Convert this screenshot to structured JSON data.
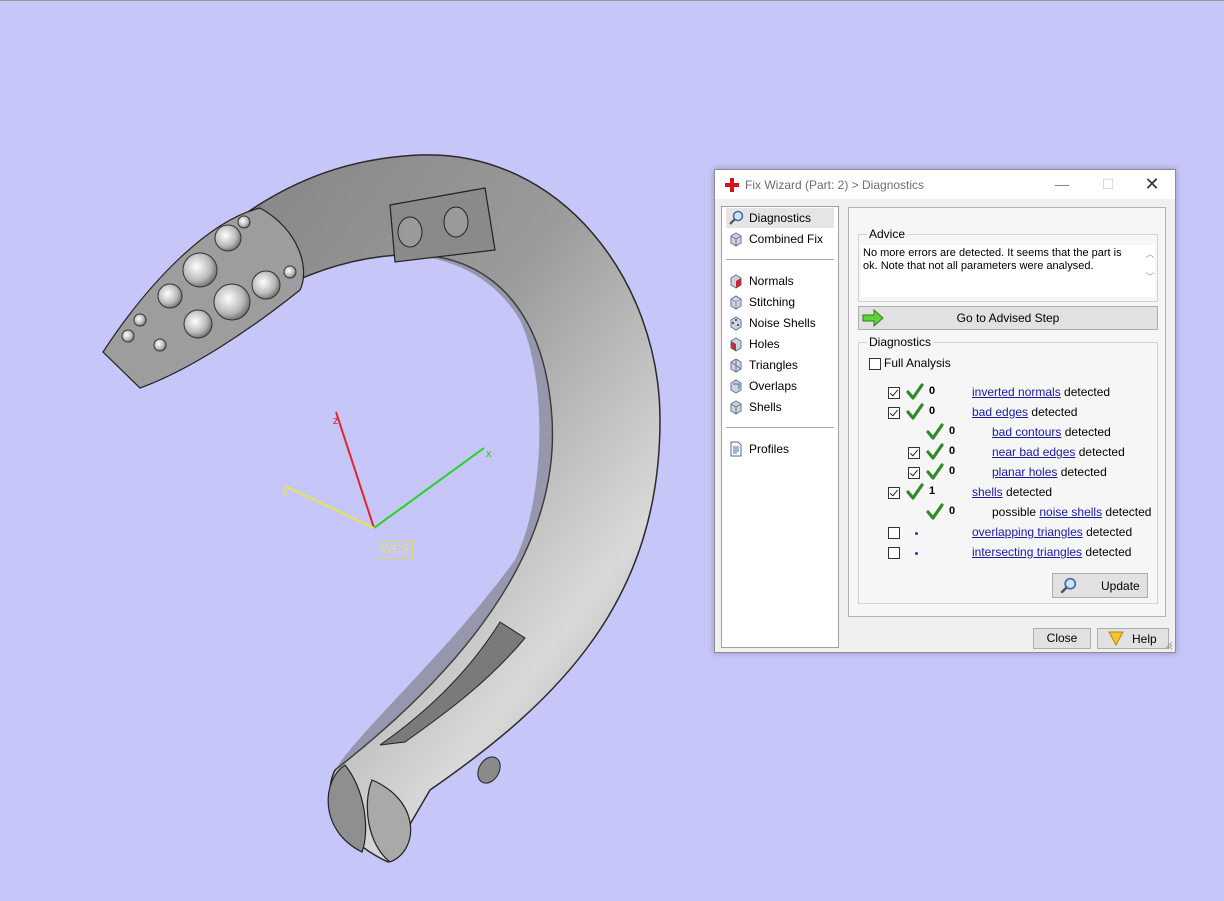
{
  "viewport": {
    "background": "#c6c6f8",
    "wcs_label": "WCS",
    "axes": {
      "x": "x",
      "y": "y",
      "z": "z"
    }
  },
  "dialog": {
    "title": "Fix Wizard (Part: 2) > Diagnostics",
    "window_buttons": {
      "minimize": "—",
      "maximize": "☐",
      "close": "✕"
    },
    "nav": {
      "group1": [
        {
          "label": "Diagnostics",
          "icon": "magnifier-icon"
        },
        {
          "label": "Combined Fix",
          "icon": "cube-icon"
        }
      ],
      "group2": [
        {
          "label": "Normals",
          "icon": "red-cube-icon"
        },
        {
          "label": "Stitching",
          "icon": "stitch-cube-icon"
        },
        {
          "label": "Noise Shells",
          "icon": "noise-cube-icon"
        },
        {
          "label": "Holes",
          "icon": "hole-cube-icon"
        },
        {
          "label": "Triangles",
          "icon": "triangle-cube-icon"
        },
        {
          "label": "Overlaps",
          "icon": "overlap-cube-icon"
        },
        {
          "label": "Shells",
          "icon": "shell-cube-icon"
        }
      ],
      "group3": [
        {
          "label": "Profiles",
          "icon": "document-icon"
        }
      ]
    },
    "advice": {
      "title": "Advice",
      "text": "No more errors are detected. It seems that the part is ok. Note that not all parameters were analysed."
    },
    "advised_button": "Go to Advised Step",
    "diagnostics": {
      "title": "Diagnostics",
      "full_analysis": {
        "label": "Full Analysis",
        "checked": false
      },
      "rows": [
        {
          "checked": true,
          "status": "ok",
          "count": "0",
          "prefix": "",
          "link": "inverted normals",
          "suffix": " detected",
          "indent": 0
        },
        {
          "checked": true,
          "status": "ok",
          "count": "0",
          "prefix": "",
          "link": "bad edges",
          "suffix": " detected",
          "indent": 0
        },
        {
          "checked": null,
          "status": "ok",
          "count": "0",
          "prefix": "",
          "link": "bad contours",
          "suffix": " detected",
          "indent": 1
        },
        {
          "checked": true,
          "status": "ok",
          "count": "0",
          "prefix": "",
          "link": "near bad edges",
          "suffix": " detected",
          "indent": 1
        },
        {
          "checked": true,
          "status": "ok",
          "count": "0",
          "prefix": "",
          "link": "planar holes",
          "suffix": " detected",
          "indent": 1
        },
        {
          "checked": true,
          "status": "ok",
          "count": "1",
          "prefix": "",
          "link": "shells",
          "suffix": " detected",
          "indent": 0
        },
        {
          "checked": null,
          "status": "ok",
          "count": "0",
          "prefix": "possible ",
          "link": "noise shells",
          "suffix": " detected",
          "indent": 1
        },
        {
          "checked": false,
          "status": "none",
          "count": "",
          "prefix": "",
          "link": "overlapping triangles",
          "suffix": " detected",
          "indent": 0
        },
        {
          "checked": false,
          "status": "none",
          "count": "",
          "prefix": "",
          "link": "intersecting triangles",
          "suffix": " detected",
          "indent": 0
        }
      ],
      "update_button": "Update"
    },
    "close_button": "Close",
    "help_button": "Help"
  }
}
